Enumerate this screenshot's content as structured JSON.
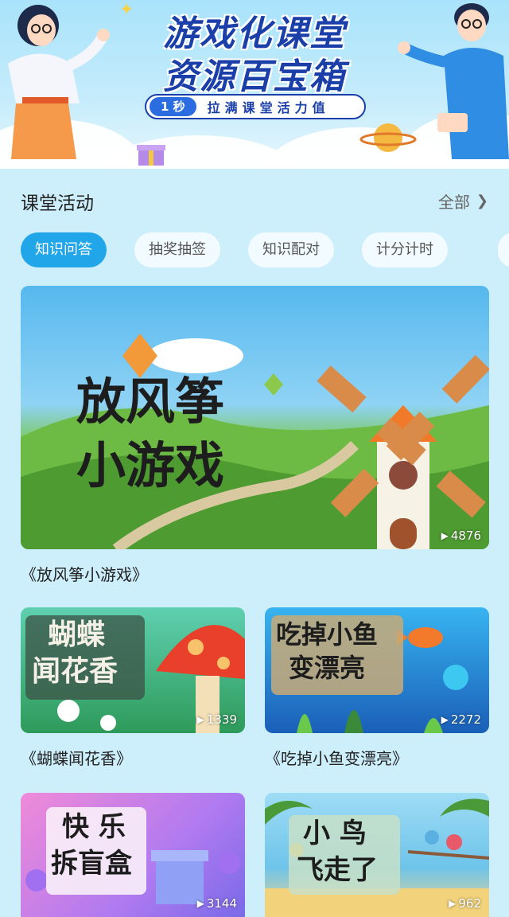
{
  "banner": {
    "title_line1": "游戏化课堂",
    "title_line2": "资源百宝箱",
    "pill_time": "1 秒",
    "pill_text": "拉满课堂活力值"
  },
  "section": {
    "title": "课堂活动",
    "more_label": "全部"
  },
  "tabs": [
    {
      "label": "知识问答",
      "active": true
    },
    {
      "label": "抽奖抽签",
      "active": false
    },
    {
      "label": "知识配对",
      "active": false
    },
    {
      "label": "计分计时",
      "active": false
    }
  ],
  "featured": {
    "art_line1": "放风筝",
    "art_line2": "小游戏",
    "plays": "4876",
    "caption": "《放风筝小游戏》"
  },
  "cards": [
    {
      "art_line1": "蝴蝶",
      "art_line2": "闻花香",
      "plays": "1339",
      "caption": "《蝴蝶闻花香》"
    },
    {
      "art_line1": "吃掉小鱼",
      "art_line2": "变漂亮",
      "plays": "2272",
      "caption": "《吃掉小鱼变漂亮》"
    },
    {
      "art_line1": "快 乐",
      "art_line2": "拆盲盒",
      "plays": "3144",
      "caption": ""
    },
    {
      "art_line1": "小 鸟",
      "art_line2": "飞走了",
      "plays": "962",
      "caption": ""
    }
  ],
  "colors": {
    "page_bg": "#cdeefb",
    "accent": "#22a6ea",
    "banner_title": "#1b3fa8"
  }
}
